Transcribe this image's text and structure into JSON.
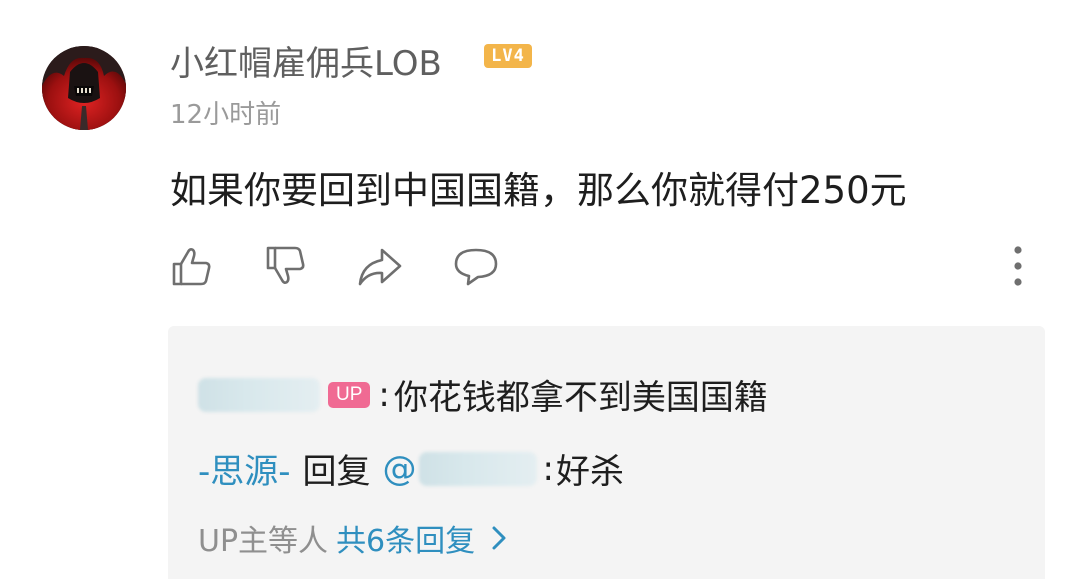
{
  "comment": {
    "username": "小红帽雇佣兵LOB",
    "level_badge": "LV4",
    "timestamp": "12小时前",
    "text": "如果你要回到中国国籍，那么你就得付250元"
  },
  "actions": [
    {
      "name": "like-icon"
    },
    {
      "name": "dislike-icon"
    },
    {
      "name": "share-icon"
    },
    {
      "name": "reply-icon"
    },
    {
      "name": "more-options-icon"
    }
  ],
  "replies": {
    "reply1": {
      "author_hidden": true,
      "badge": "UP",
      "separator": ":",
      "text": "你花钱都拿不到美国国籍"
    },
    "reply2": {
      "author": "-思源-",
      "reply_word": "回复",
      "mention_prefix": "@",
      "mention_hidden": true,
      "separator": ":",
      "text": "好杀"
    },
    "more": {
      "prefix": "UP主等人",
      "link": "共6条回复"
    }
  },
  "colors": {
    "link_blue": "#2f8fbf",
    "up_badge_pink": "#f06a93",
    "level_badge_orange": "#f3b54a",
    "reply_bg": "#f4f4f4"
  }
}
